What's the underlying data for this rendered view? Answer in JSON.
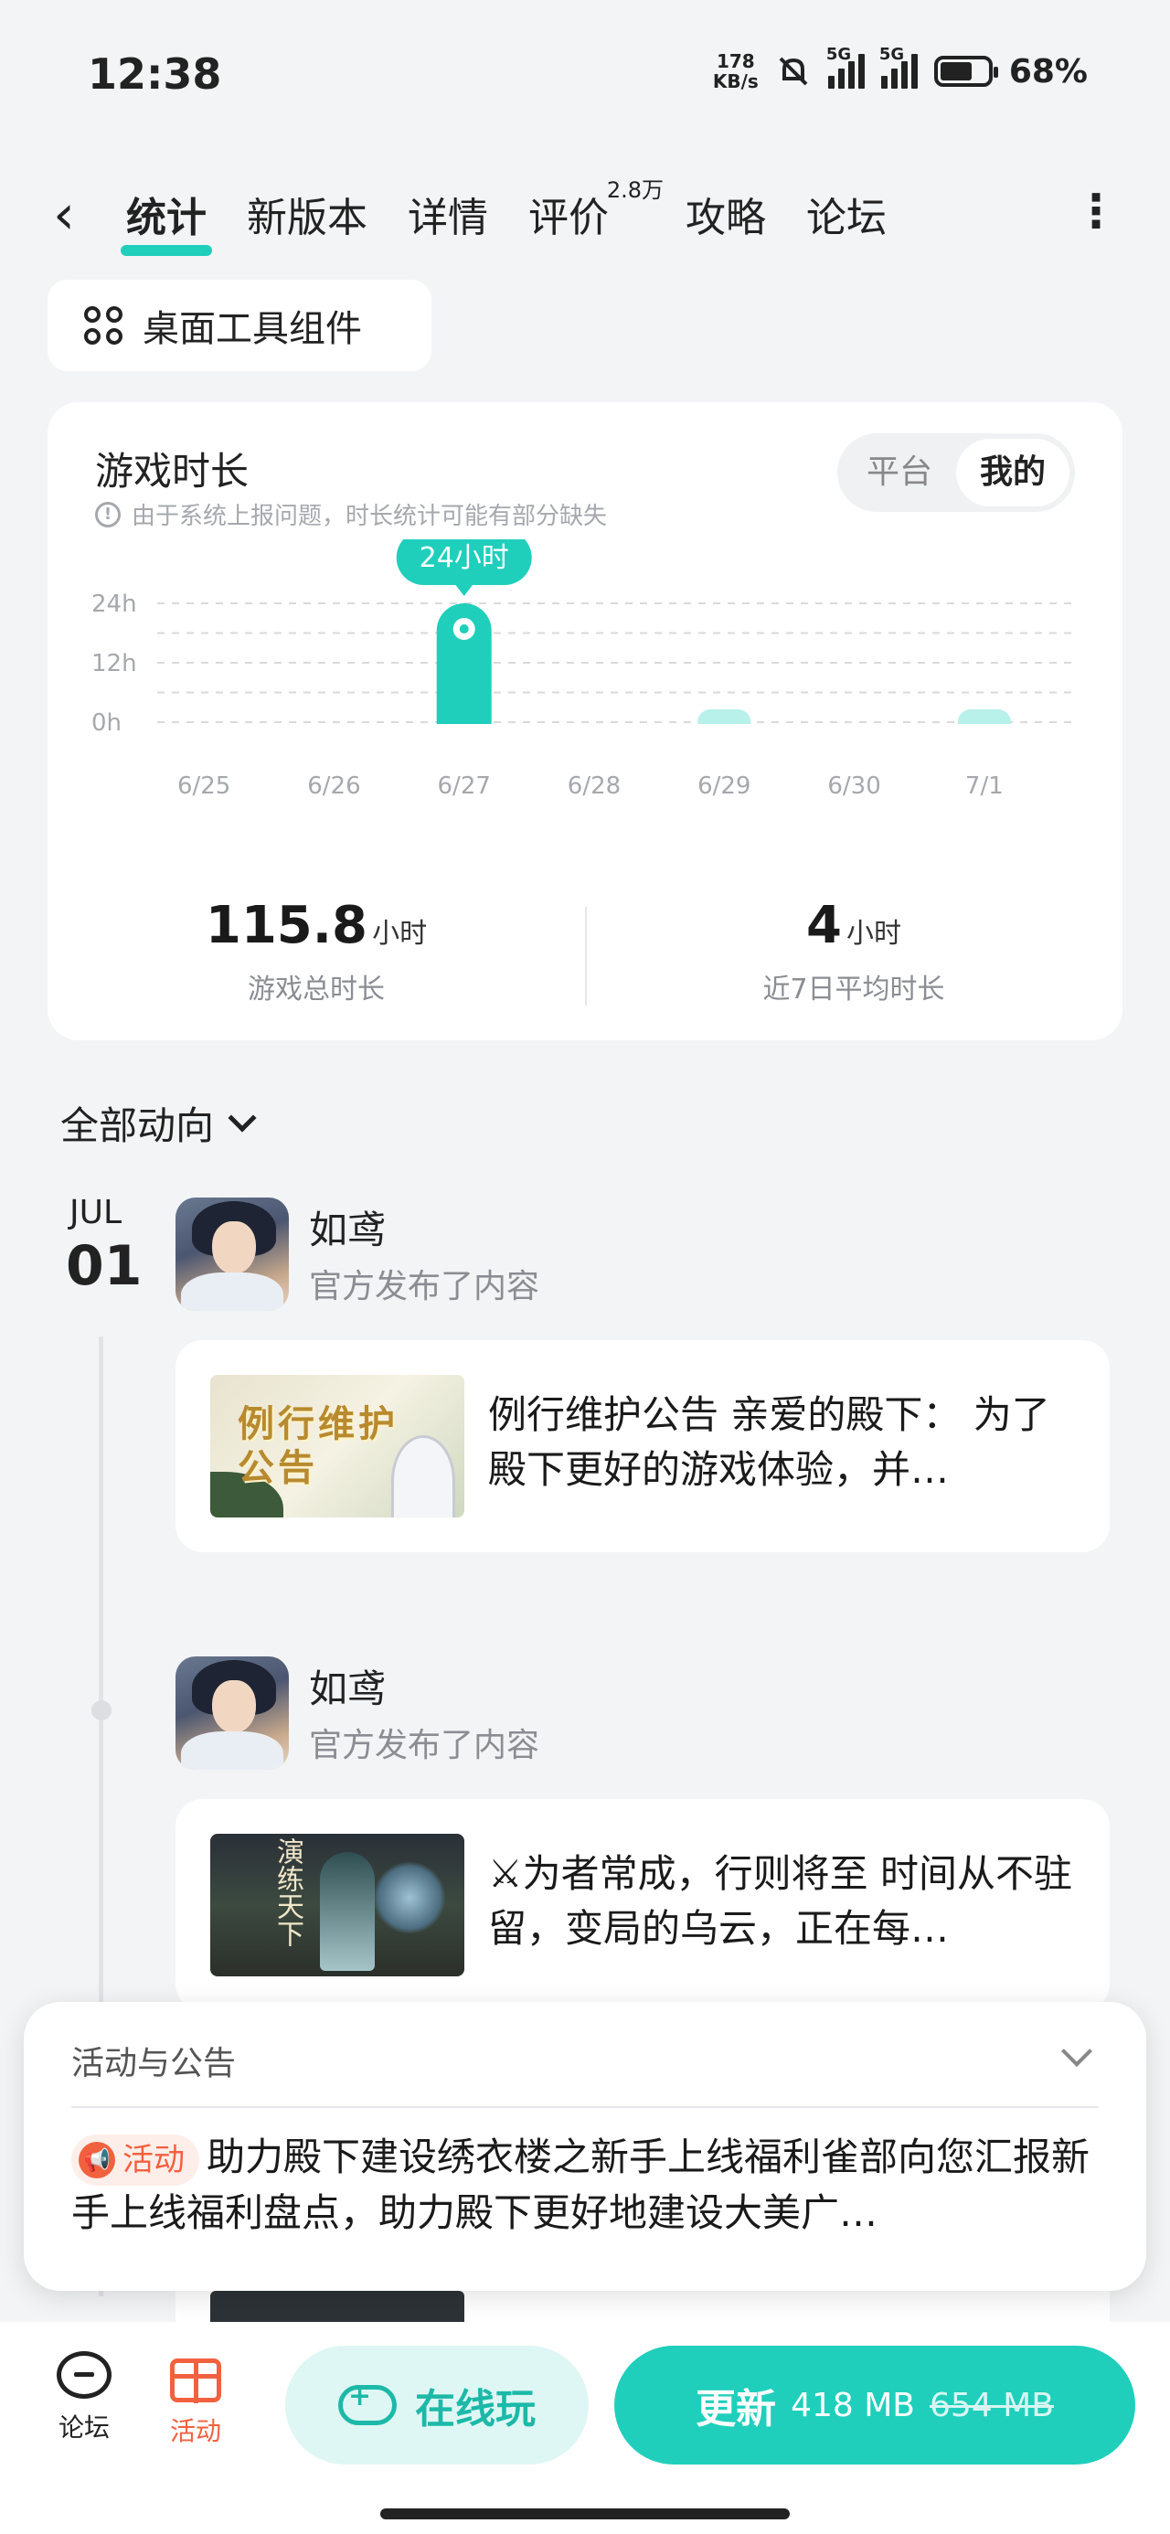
{
  "status_bar": {
    "time": "12:38",
    "net_speed_value": "178",
    "net_speed_unit": "KB/s",
    "sim1_label": "5G",
    "sim2_label": "5G",
    "battery_pct": "68%",
    "battery_level": 0.68,
    "icons": [
      "mute-bell-icon",
      "signal-icon",
      "signal-icon",
      "battery-icon"
    ]
  },
  "nav": {
    "tabs": [
      {
        "label": "统计",
        "active": true
      },
      {
        "label": "新版本"
      },
      {
        "label": "详情"
      },
      {
        "label": "评价",
        "sup": "2.8万"
      },
      {
        "label": "攻略"
      },
      {
        "label": "论坛"
      }
    ]
  },
  "widget_chip": {
    "label": "桌面工具组件",
    "icon": "widgets-icon"
  },
  "stats": {
    "title": "游戏时长",
    "note": "由于系统上报问题，时长统计可能有部分缺失",
    "segment": {
      "options": [
        "平台",
        "我的"
      ],
      "selected": "我的"
    },
    "total_value": "115.8",
    "total_unit": "小时",
    "total_label": "游戏总时长",
    "avg_value": "4",
    "avg_unit": "小时",
    "avg_label": "近7日平均时长"
  },
  "chart_data": {
    "type": "bar",
    "categories": [
      "6/25",
      "6/26",
      "6/27",
      "6/28",
      "6/29",
      "6/30",
      "7/1"
    ],
    "values": [
      0,
      0,
      24,
      0,
      0.5,
      0,
      1.5
    ],
    "y_ticks": [
      "0h",
      "12h",
      "24h"
    ],
    "ylim": [
      0,
      24
    ],
    "highlight_index": 2,
    "tooltip": "24小时",
    "colors": {
      "bar": "#1fcfbc",
      "bar_light": "#b8f0ea"
    }
  },
  "feed": {
    "filter_label": "全部动向",
    "date_month": "JUL",
    "date_day": "01",
    "items": [
      {
        "publisher": "如鸢",
        "action": "官方发布了内容",
        "thumb_text": "例行维护公告",
        "text": "例行维护公告 亲爱的殿下： 为了殿下更好的游戏体验，并…"
      },
      {
        "publisher": "如鸢",
        "action": "官方发布了内容",
        "thumb_text": "演练天下",
        "text": "⚔为者常成，行则将至 时间从不驻留，变局的乌云，正在每…"
      }
    ]
  },
  "announcement": {
    "title": "活动与公告",
    "badge": "活动",
    "text": "助力殿下建设绣衣楼之新手上线福利雀部向您汇报新手上线福利盘点，助力殿下更好地建设大美广…"
  },
  "bottom_bar": {
    "forum_label": "论坛",
    "activity_label": "活动",
    "online_play_label": "在线玩",
    "update_label": "更新",
    "update_size": "418 MB",
    "update_old_size": "654 MB"
  },
  "colors": {
    "accent": "#1fcfbc",
    "activity": "#f2613f",
    "bg": "#f3f4f6"
  }
}
